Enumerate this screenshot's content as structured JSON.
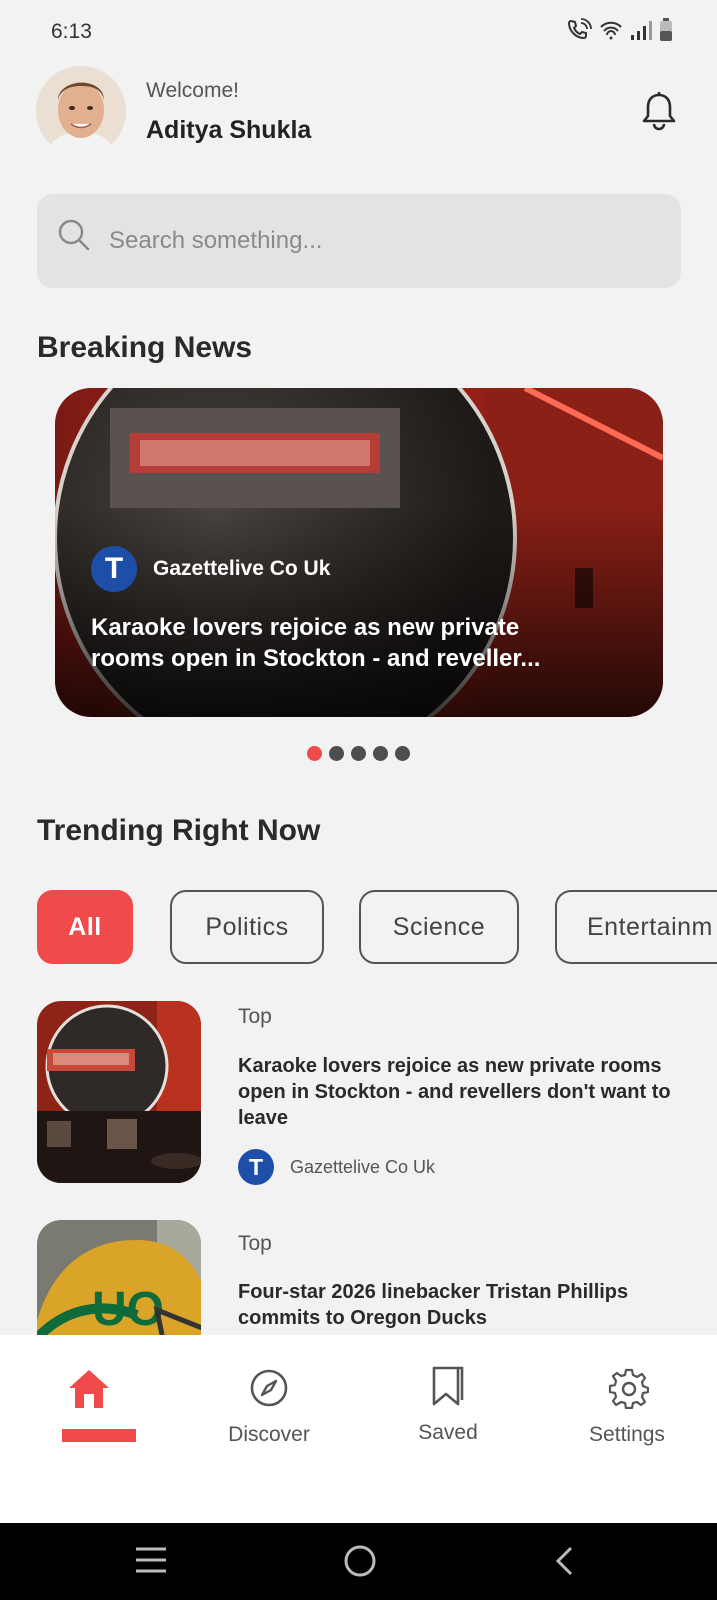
{
  "status_bar": {
    "time": "6:13"
  },
  "header": {
    "welcome": "Welcome!",
    "user_name": "Aditya Shukla"
  },
  "search": {
    "placeholder": "Search something..."
  },
  "breaking": {
    "title": "Breaking News",
    "card": {
      "source_initial": "T",
      "source": "Gazettelive Co Uk",
      "headline": "Karaoke lovers rejoice as new private rooms open in Stockton - and reveller..."
    },
    "dots": 5,
    "active_dot": 1
  },
  "trending": {
    "title": "Trending Right Now",
    "chips": [
      "All",
      "Politics",
      "Science",
      "Entertainm"
    ],
    "active_chip": "All",
    "items": [
      {
        "category": "Top",
        "title": "Karaoke lovers rejoice as new private rooms open in Stockton - and revellers don't want to leave",
        "source_initial": "T",
        "source": "Gazettelive Co Uk"
      },
      {
        "category": "Top",
        "title": "Four-star 2026 linebacker Tristan Phillips commits to Oregon Ducks"
      }
    ]
  },
  "bottom_nav": {
    "items": [
      {
        "label": "",
        "icon": "home-icon",
        "active": true
      },
      {
        "label": "Discover",
        "icon": "compass-icon"
      },
      {
        "label": "Saved",
        "icon": "bookmark-icon"
      },
      {
        "label": "Settings",
        "icon": "gear-icon"
      }
    ]
  },
  "colors": {
    "accent": "#f04a4a",
    "background": "#f2f2f2",
    "source_logo": "#1d4fa8"
  }
}
